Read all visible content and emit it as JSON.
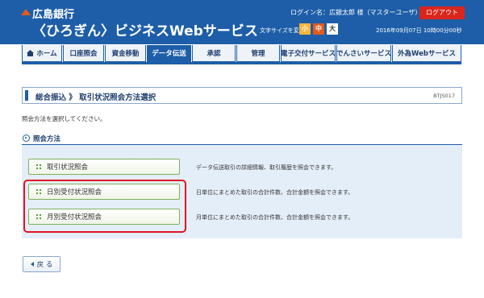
{
  "header": {
    "bank_name": "広島銀行",
    "service_name": "〈ひろぎん〉ビジネスWebサービス",
    "login_info": "ログイン名：広銀太郎 様（マスターユーザ）",
    "logout_label": "ログアウト",
    "fontsize_label": "文字サイズを変更",
    "fontsize_small": "小",
    "fontsize_medium": "中",
    "fontsize_large": "大",
    "datetime": "2016年09月07日 10時00分00秒"
  },
  "nav": {
    "tabs": [
      {
        "label": "ホーム",
        "active": false
      },
      {
        "label": "口座照会",
        "active": false
      },
      {
        "label": "資金移動",
        "active": false
      },
      {
        "label": "データ伝送",
        "active": true
      },
      {
        "label": "承認",
        "active": false
      },
      {
        "label": "管理",
        "active": false
      },
      {
        "label": "電子交付サービス",
        "active": false
      },
      {
        "label": "でんさいサービス",
        "active": false
      },
      {
        "label": "外為Webサービス",
        "active": false
      }
    ]
  },
  "page": {
    "title": "総合振込 》 取引状況照会方法選択",
    "screen_id": "BTJS017",
    "instruction": "照会方法を選択してください。",
    "section_title": "照会方法"
  },
  "options": [
    {
      "label": "取引状況照会",
      "description": "データ伝送取引の詳細情報、取引履歴を照会できます。"
    },
    {
      "label": "日別受付状況照会",
      "description": "日単位にまとめた取引の合計件数、合計金額を照会できます。"
    },
    {
      "label": "月別受付状況照会",
      "description": "月単位にまとめた取引の合計件数、合計金額を照会できます。"
    }
  ],
  "back_label": "戻 る",
  "colors": {
    "header_blue": "#1e5ea8",
    "logout_red": "#d9261c",
    "highlight_red": "#e0141e",
    "option_green": "#5a9e2f"
  }
}
